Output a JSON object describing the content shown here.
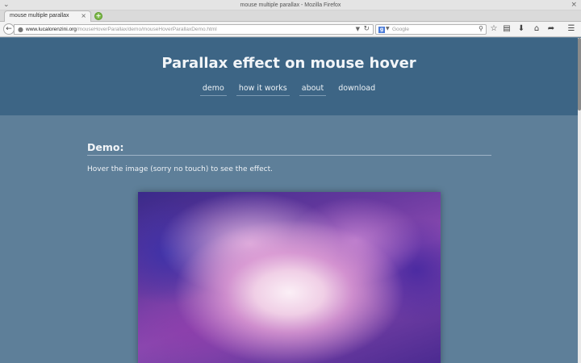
{
  "window": {
    "title": "mouse multiple parallax - Mozilla Firefox",
    "left_button": "⌄",
    "close_button": "×"
  },
  "tab": {
    "label": "mouse multiple parallax",
    "close": "×",
    "new_tab": "+"
  },
  "navbar": {
    "url_host": "www.lucalorenzini.org",
    "url_path": "/mouseHoverParallax/demo/mouseHoverParallaxDemo.html",
    "search_placeholder": "Google",
    "search_engine_letter": "g"
  },
  "page": {
    "title": "Parallax effect on mouse hover",
    "nav": [
      "demo",
      "how it works",
      "about",
      "download"
    ],
    "section_title": "Demo:",
    "section_text": "Hover the image (sorry no touch) to see the effect."
  },
  "colors": {
    "header_bg": "#3d6585",
    "page_bg": "#5e7f99",
    "text": "#f2f5f8"
  },
  "icons": [
    "back-arrow-icon",
    "globe-icon",
    "reload-icon",
    "search-icon",
    "bookmark-star-icon",
    "reading-list-icon",
    "download-icon",
    "home-icon",
    "share-icon",
    "menu-icon"
  ]
}
